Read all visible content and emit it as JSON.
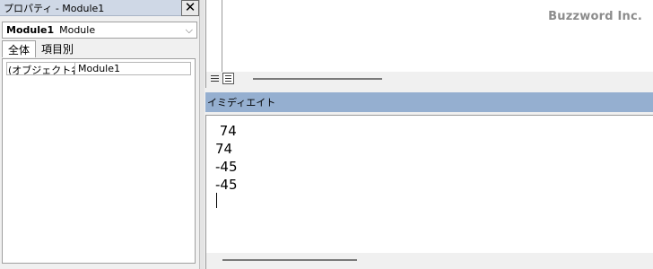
{
  "properties_panel": {
    "title": "プロパティ - Module1",
    "close_icon": "close-icon",
    "object_select": {
      "name": "Module1",
      "type": "Module"
    },
    "tabs": [
      {
        "label": "全体",
        "active": true
      },
      {
        "label": "項目別",
        "active": false
      }
    ],
    "rows": [
      {
        "name": "(オブジェクト名)",
        "value": "Module1"
      }
    ]
  },
  "code_window": {
    "watermark": "Buzzword Inc.",
    "view_buttons": [
      "procedure-view-icon",
      "full-module-view-icon"
    ]
  },
  "immediate_window": {
    "title": "イミディエイト",
    "lines": [
      " 74",
      "74",
      "-45",
      "-45"
    ]
  },
  "colors": {
    "immediate_title_bg": "#95afd0",
    "properties_title_bg": "#cfd8e6"
  }
}
